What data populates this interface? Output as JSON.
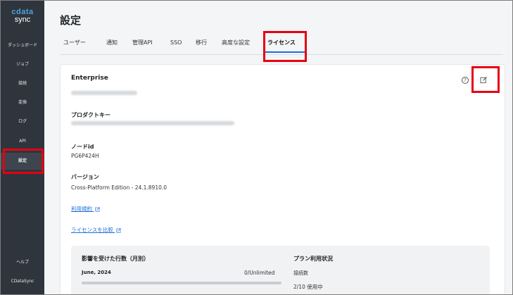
{
  "app": {
    "logo_top": "cdata",
    "logo_bottom": "sync"
  },
  "sidebar": {
    "items": [
      {
        "label": "ダッシュボード"
      },
      {
        "label": "ジョブ"
      },
      {
        "label": "接続"
      },
      {
        "label": "変換"
      },
      {
        "label": "ログ"
      },
      {
        "label": "API"
      },
      {
        "label": "設定"
      }
    ],
    "bottom": [
      {
        "label": "ヘルプ"
      },
      {
        "label": "CDataSync"
      }
    ]
  },
  "header": {
    "title": "設定"
  },
  "tabs": [
    {
      "label": "ユーザー"
    },
    {
      "label": "通知"
    },
    {
      "label": "管理API"
    },
    {
      "label": "SSO"
    },
    {
      "label": "移行"
    },
    {
      "label": "高度な設定"
    },
    {
      "label": "ライセンス"
    }
  ],
  "license": {
    "edition": "Enterprise",
    "product_key_label": "プロダクトキー",
    "node_id_label": "ノードid",
    "node_id": "PG6P424H",
    "version_label": "バージョン",
    "version": "Cross-Platform Edition - 24.1.8910.0",
    "terms_link": "利用規約",
    "compare_link": "ライセンスを比較",
    "help_icon": "?"
  },
  "usage": {
    "title": "影響を受けた行数（月別）",
    "month": "June, 2024",
    "count": "0/Unlimited",
    "progress": 0,
    "plan_title": "プラン利用状況",
    "plan_connections_label": "接続数",
    "plan_connections_value": "2/10 使用中"
  },
  "colors": {
    "accent": "#1e6fd9",
    "sidebar_bg": "#2f353d",
    "highlight": "#e60012"
  }
}
